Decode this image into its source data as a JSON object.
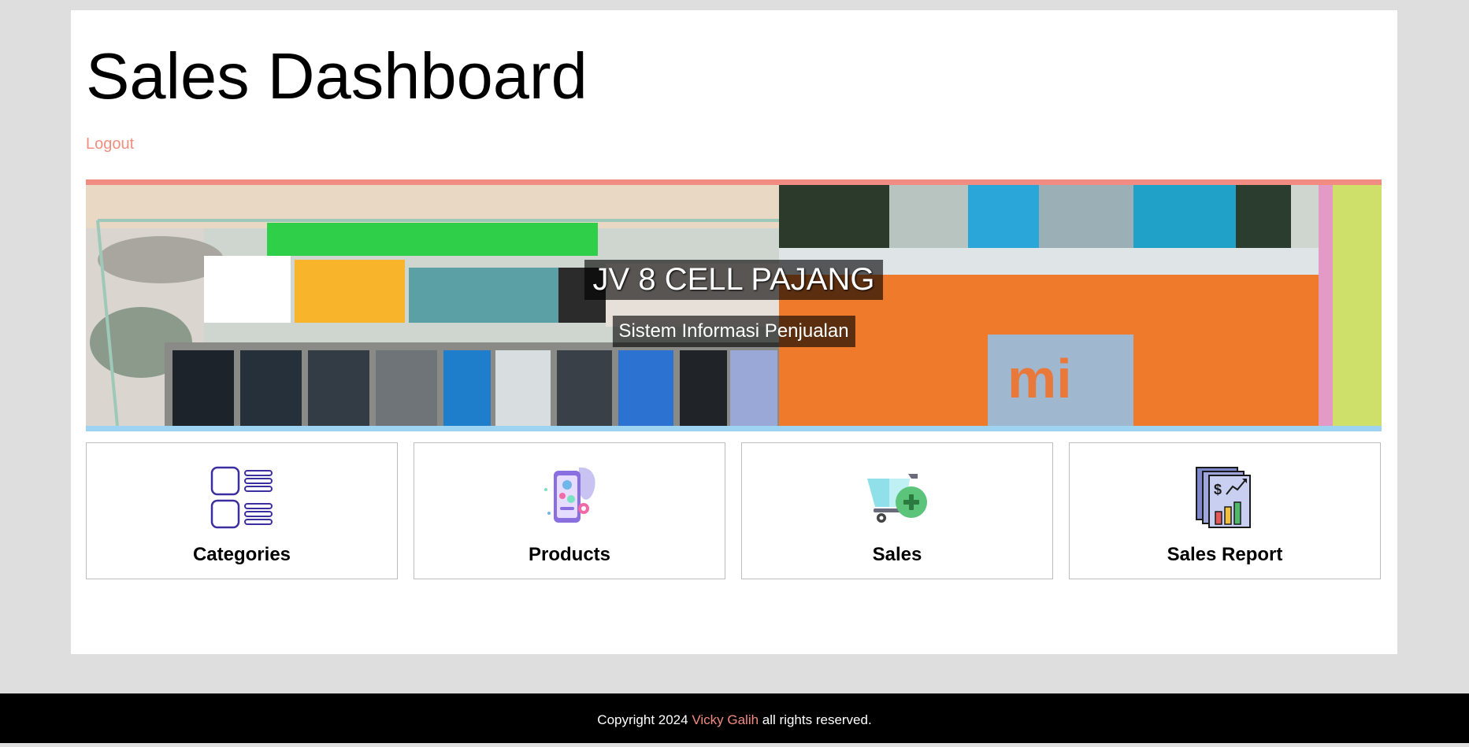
{
  "header": {
    "title": "Sales Dashboard",
    "logout_label": "Logout"
  },
  "hero": {
    "title": "JV 8 CELL PAJANG",
    "subtitle": "Sistem Informasi Penjualan"
  },
  "cards": [
    {
      "label": "Categories",
      "icon": "categories-icon"
    },
    {
      "label": "Products",
      "icon": "products-icon"
    },
    {
      "label": "Sales",
      "icon": "sales-cart-icon"
    },
    {
      "label": "Sales Report",
      "icon": "sales-report-icon"
    }
  ],
  "footer": {
    "prefix": "Copyright 2024",
    "author": "Vicky Galih",
    "suffix": "all rights reserved."
  },
  "colors": {
    "accent": "#f28b82",
    "hero_bottom_border": "#9fd3f2",
    "footer_bg": "#000000",
    "page_bg": "#dedede"
  }
}
